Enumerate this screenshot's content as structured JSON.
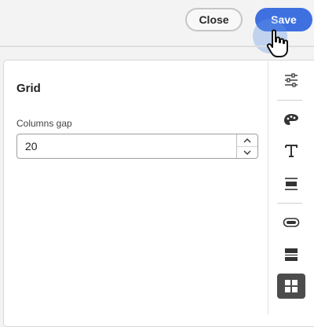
{
  "header": {
    "close_label": "Close",
    "save_label": "Save"
  },
  "panel": {
    "title": "Grid",
    "columns_gap": {
      "label": "Columns gap",
      "value": "20"
    }
  },
  "toolbar": {
    "icons": [
      "sliders-icon",
      "palette-icon",
      "text-icon",
      "align-icon",
      "button-icon",
      "divider-icon",
      "grid-icon"
    ],
    "active": "grid-icon"
  },
  "colors": {
    "accent": "#3f70e0",
    "active_tool": "#4c4c4c"
  }
}
